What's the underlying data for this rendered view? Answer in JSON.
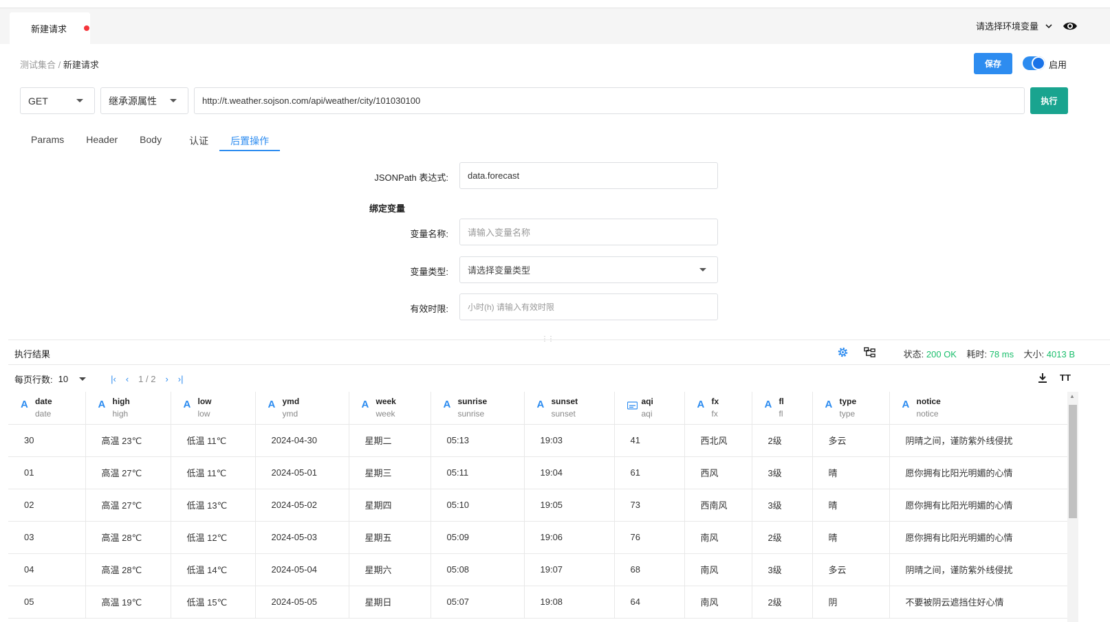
{
  "tab": {
    "title": "新建请求"
  },
  "env": {
    "label": "请选择环境变量"
  },
  "breadcrumb": {
    "parent": "测试集合",
    "sep": " / ",
    "current": "新建请求"
  },
  "toolbar": {
    "save_label": "保存",
    "toggle_label": "启用",
    "toggle_on": true,
    "run_label": "执行"
  },
  "request": {
    "method": "GET",
    "inherit": "继承源属性",
    "url": "http://t.weather.sojson.com/api/weather/city/101030100"
  },
  "tabs": [
    "Params",
    "Header",
    "Body",
    "认证",
    "后置操作"
  ],
  "active_tab": "后置操作",
  "post": {
    "jsonpath_label": "JSONPath 表达式:",
    "jsonpath_value": "data.forecast",
    "bind_title": "绑定变量",
    "var_name_label": "变量名称:",
    "var_name_placeholder": "请输入变量名称",
    "var_type_label": "变量类型:",
    "var_type_placeholder": "请选择变量类型",
    "ttl_label": "有效时限:",
    "ttl_placeholder": "小时(h) 请输入有效时限"
  },
  "result": {
    "title": "执行结果",
    "status_label": "状态:",
    "status_value": "200 OK",
    "time_label": "耗时:",
    "time_value": "78 ms",
    "size_label": "大小:",
    "size_value": "4013 B",
    "rows_label": "每页行数:",
    "rows_value": "10",
    "page": "1 / 2",
    "font_tool": "TT"
  },
  "table": {
    "columns": [
      {
        "name": "date",
        "sub": "date",
        "icon": "A"
      },
      {
        "name": "high",
        "sub": "high",
        "icon": "A"
      },
      {
        "name": "low",
        "sub": "low",
        "icon": "A"
      },
      {
        "name": "ymd",
        "sub": "ymd",
        "icon": "A"
      },
      {
        "name": "week",
        "sub": "week",
        "icon": "A"
      },
      {
        "name": "sunrise",
        "sub": "sunrise",
        "icon": "A"
      },
      {
        "name": "sunset",
        "sub": "sunset",
        "icon": "A"
      },
      {
        "name": "aqi",
        "sub": "aqi",
        "icon": "number"
      },
      {
        "name": "fx",
        "sub": "fx",
        "icon": "A"
      },
      {
        "name": "fl",
        "sub": "fl",
        "icon": "A"
      },
      {
        "name": "type",
        "sub": "type",
        "icon": "A"
      },
      {
        "name": "notice",
        "sub": "notice",
        "icon": "A"
      }
    ],
    "rows": [
      [
        "30",
        "高温 23℃",
        "低温 11℃",
        "2024-04-30",
        "星期二",
        "05:13",
        "19:03",
        "41",
        "西北风",
        "2级",
        "多云",
        "阴晴之间，谨防紫外线侵扰"
      ],
      [
        "01",
        "高温 27℃",
        "低温 11℃",
        "2024-05-01",
        "星期三",
        "05:11",
        "19:04",
        "61",
        "西风",
        "3级",
        "晴",
        "愿你拥有比阳光明媚的心情"
      ],
      [
        "02",
        "高温 27℃",
        "低温 13℃",
        "2024-05-02",
        "星期四",
        "05:10",
        "19:05",
        "73",
        "西南风",
        "3级",
        "晴",
        "愿你拥有比阳光明媚的心情"
      ],
      [
        "03",
        "高温 28℃",
        "低温 12℃",
        "2024-05-03",
        "星期五",
        "05:09",
        "19:06",
        "76",
        "南风",
        "2级",
        "晴",
        "愿你拥有比阳光明媚的心情"
      ],
      [
        "04",
        "高温 28℃",
        "低温 14℃",
        "2024-05-04",
        "星期六",
        "05:08",
        "19:07",
        "68",
        "南风",
        "3级",
        "多云",
        "阴晴之间，谨防紫外线侵扰"
      ],
      [
        "05",
        "高温 19℃",
        "低温 15℃",
        "2024-05-05",
        "星期日",
        "05:07",
        "19:08",
        "64",
        "南风",
        "2级",
        "阴",
        "不要被阴云遮挡住好心情"
      ]
    ]
  }
}
